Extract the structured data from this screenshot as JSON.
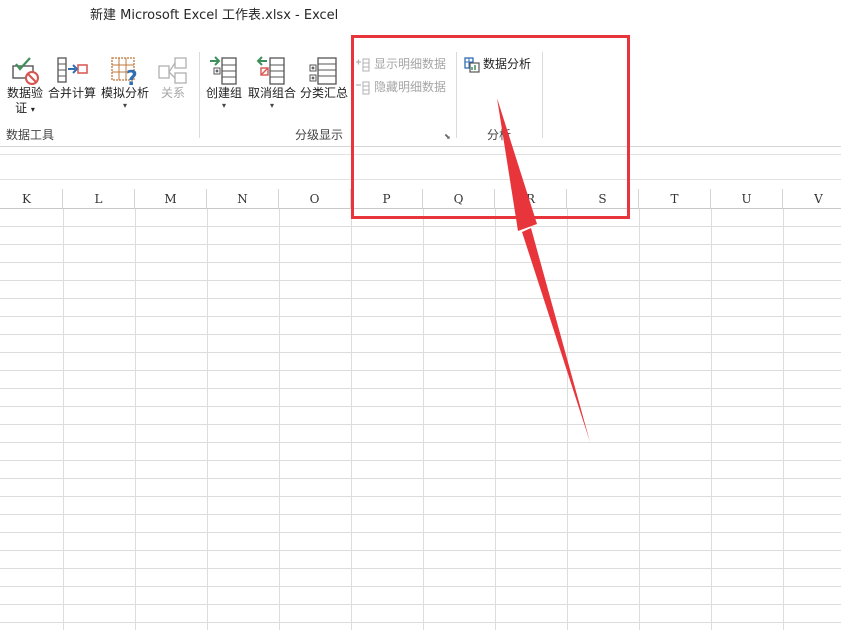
{
  "window": {
    "title": "新建 Microsoft Excel 工作表.xlsx - Excel"
  },
  "ribbon": {
    "data_tools": {
      "buttons": [
        {
          "label_line1": "数据验",
          "label_line2": "证",
          "has_dropdown": true,
          "icon": "data-validation-icon"
        },
        {
          "label": "合并计算",
          "icon": "consolidate-icon"
        },
        {
          "label": "模拟分析",
          "has_dropdown": true,
          "icon": "what-if-analysis-icon"
        },
        {
          "label": "关系",
          "disabled": true,
          "icon": "relationships-icon"
        }
      ],
      "group_label": "数据工具"
    },
    "outline": {
      "buttons": [
        {
          "label": "创建组",
          "has_dropdown": true,
          "icon": "group-icon"
        },
        {
          "label": "取消组合",
          "has_dropdown": true,
          "icon": "ungroup-icon"
        },
        {
          "label": "分类汇总",
          "icon": "subtotal-icon"
        }
      ],
      "small_buttons": [
        {
          "label": "显示明细数据",
          "disabled": true,
          "icon": "show-detail-icon"
        },
        {
          "label": "隐藏明细数据",
          "disabled": true,
          "icon": "hide-detail-icon"
        }
      ],
      "group_label": "分级显示"
    },
    "analysis": {
      "button": {
        "label": "数据分析",
        "icon": "data-analysis-icon"
      },
      "group_label": "分析"
    }
  },
  "sheet": {
    "columns": [
      "K",
      "L",
      "M",
      "N",
      "O",
      "P",
      "Q",
      "R",
      "S",
      "T",
      "U",
      "V"
    ]
  },
  "annotation": {
    "highlight_color": "#e8353b"
  },
  "colors": {
    "disabled_text": "#a6a6a6",
    "grid_line": "#dcdcdc",
    "icon_green": "#3f8f5b",
    "icon_red": "#d9534f",
    "icon_blue": "#2f6db5"
  }
}
